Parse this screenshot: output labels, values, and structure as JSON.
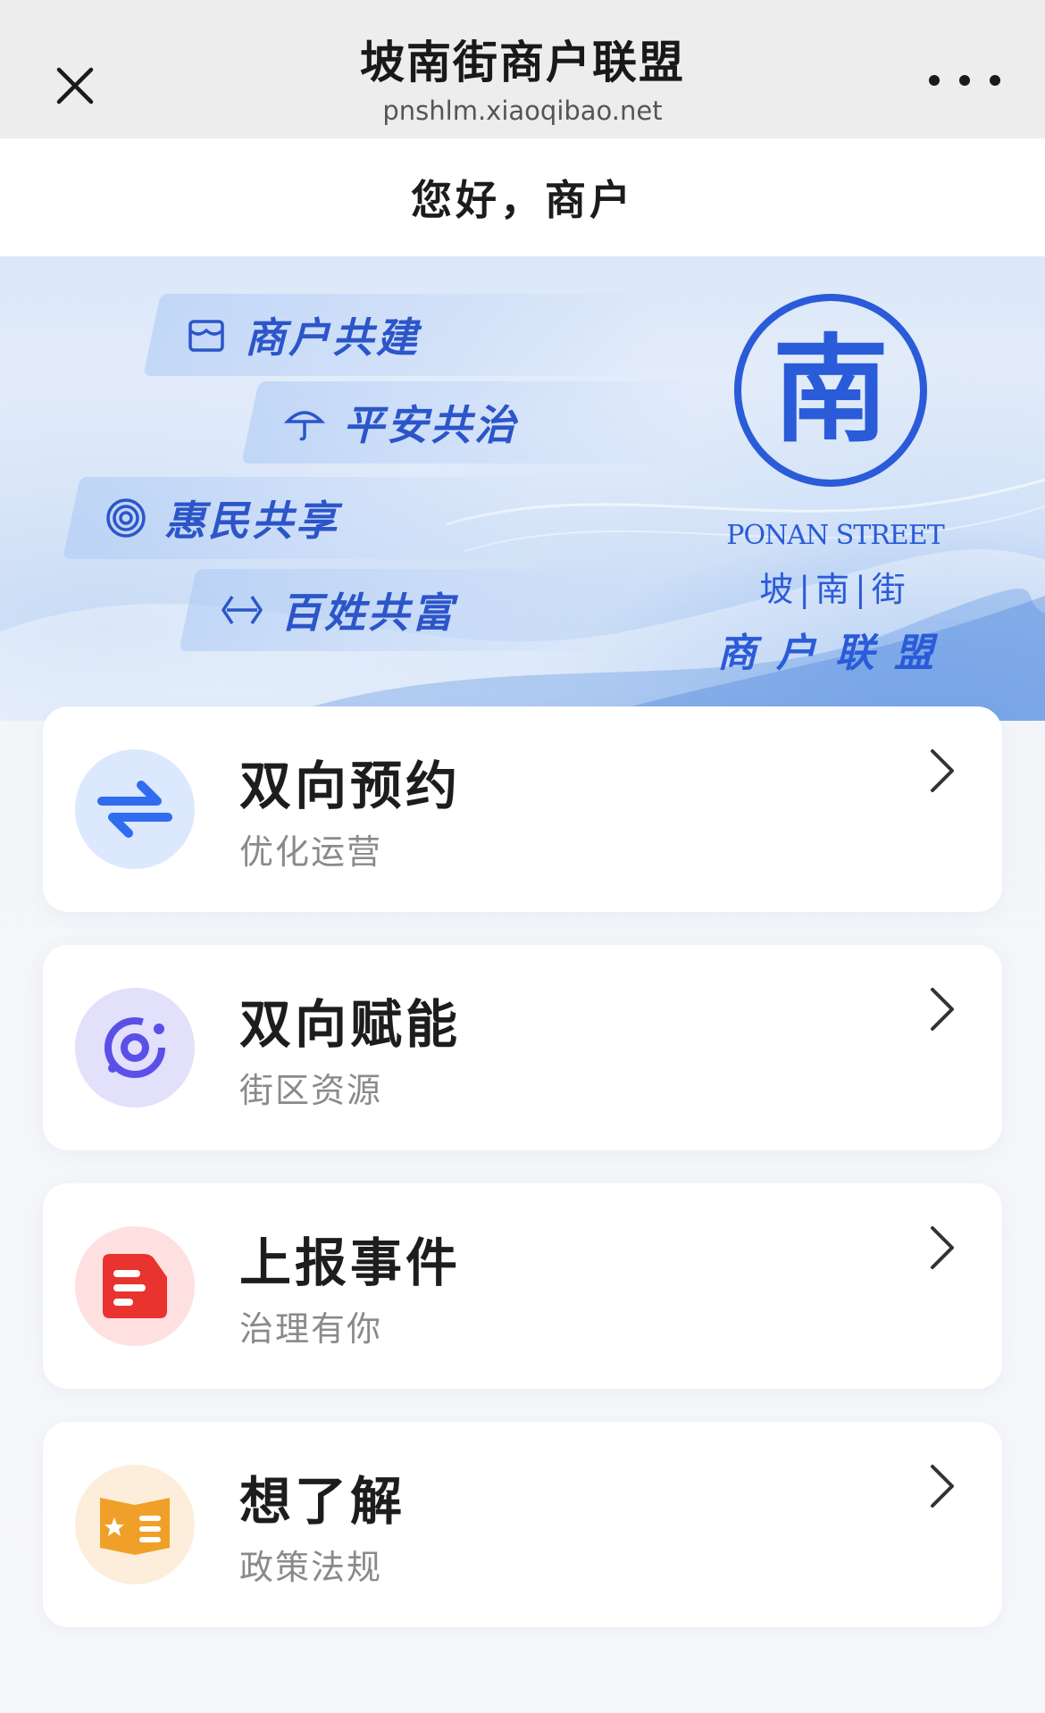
{
  "window": {
    "title": "坡南街商户联盟",
    "url": "pnshlm.xiaoqibao.net"
  },
  "greeting": "您好，商户",
  "banner": {
    "slogans": [
      {
        "label": "商户共建",
        "icon": "store-icon"
      },
      {
        "label": "平安共治",
        "icon": "umbrella-icon"
      },
      {
        "label": "惠民共享",
        "icon": "signal-icon"
      },
      {
        "label": "百姓共富",
        "icon": "exchange-icon"
      }
    ],
    "logo": {
      "glyph": "南",
      "en": "PONAN STREET",
      "cn": "坡|南|街",
      "sub": "商户联盟"
    }
  },
  "menu": [
    {
      "title": "双向预约",
      "subtitle": "优化运营",
      "icon": "swap-arrows-icon",
      "color": "#2f6cf0",
      "bg": "#dbe8fd"
    },
    {
      "title": "双向赋能",
      "subtitle": "街区资源",
      "icon": "orbit-icon",
      "color": "#5a50e8",
      "bg": "#e2e0fb"
    },
    {
      "title": "上报事件",
      "subtitle": "治理有你",
      "icon": "report-doc-icon",
      "color": "#e8332f",
      "bg": "#fde0df"
    },
    {
      "title": "想了解",
      "subtitle": "政策法规",
      "icon": "policy-book-icon",
      "color": "#f0a028",
      "bg": "#fdeedb"
    }
  ],
  "colors": {
    "accent": "#2c55c9",
    "topbar": "#ededed"
  }
}
